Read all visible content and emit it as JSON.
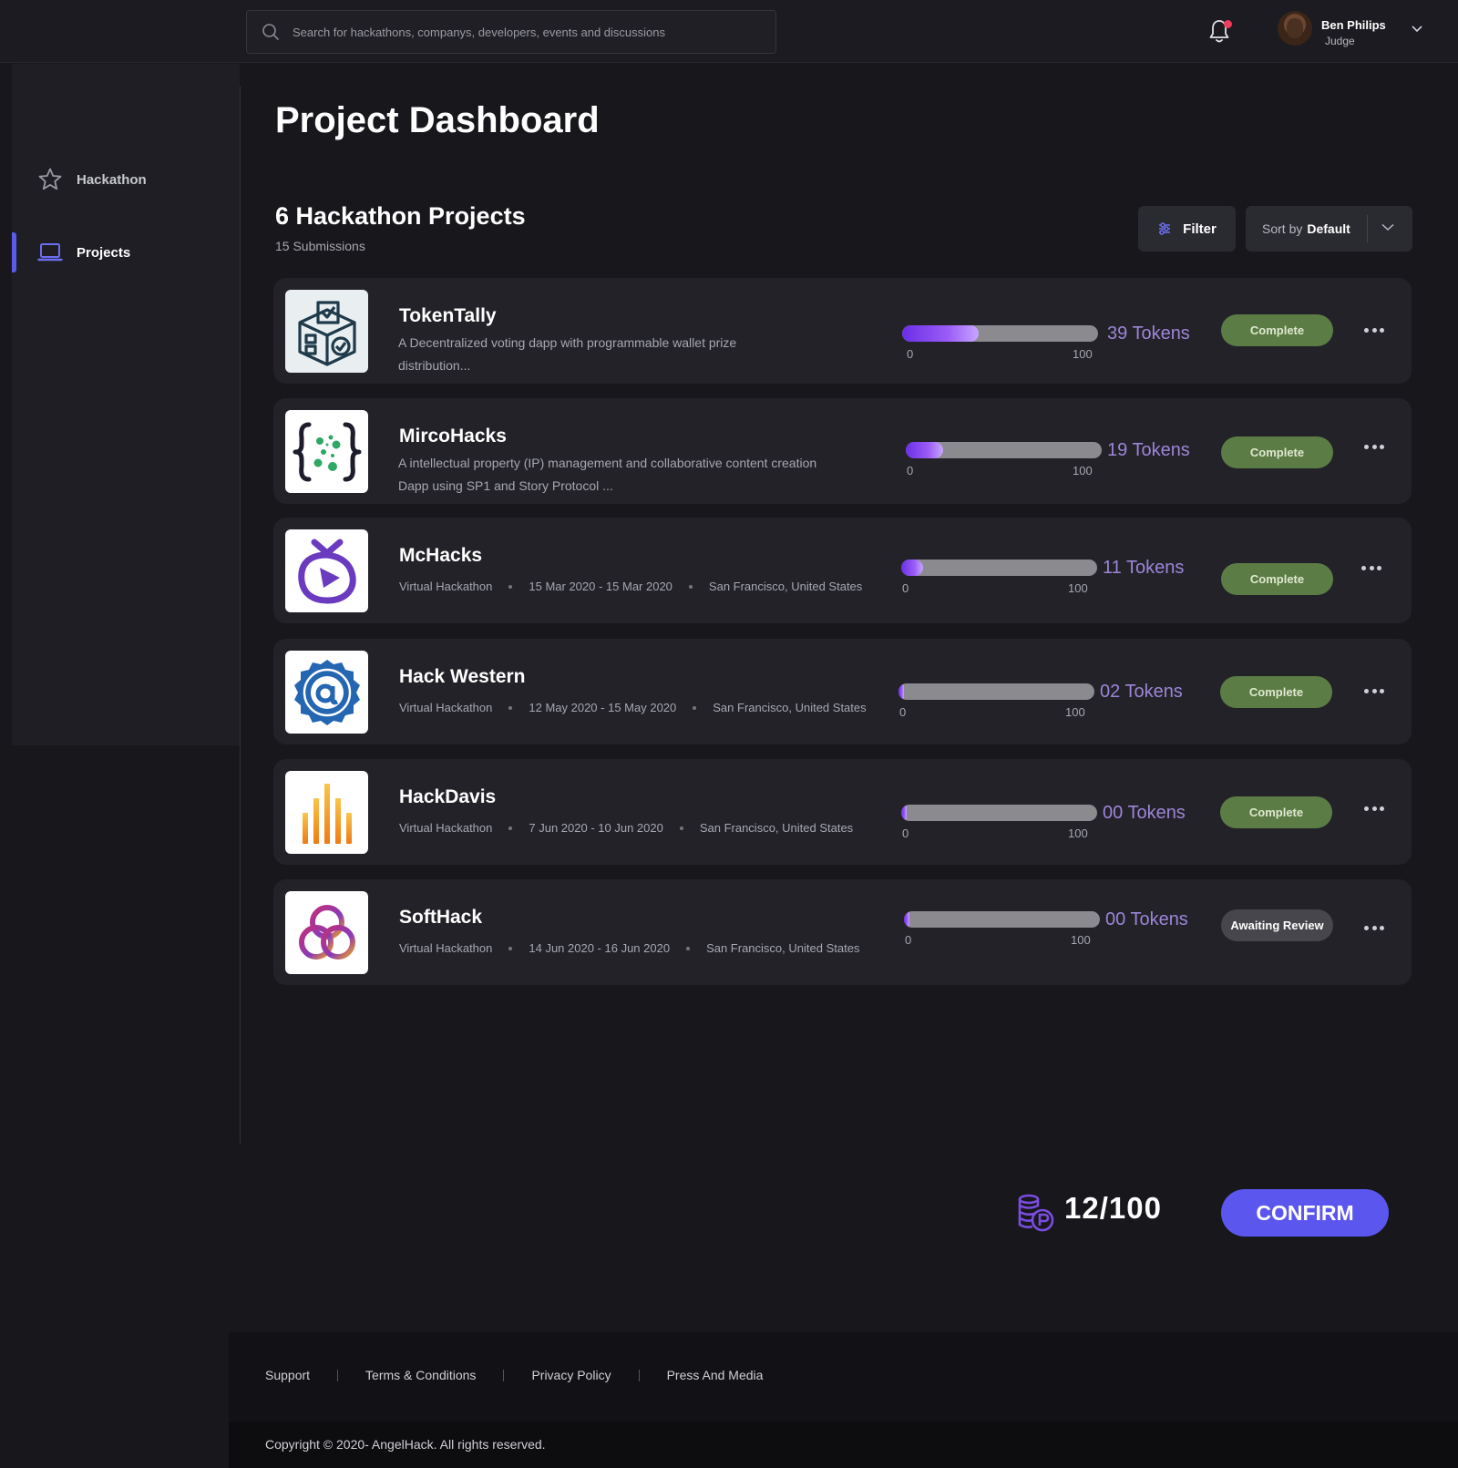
{
  "search": {
    "placeholder": "Search for hackathons, companys, developers, events and discussions"
  },
  "user": {
    "name": "Ben Philips",
    "role": "Judge"
  },
  "sidebar": {
    "items": [
      {
        "label": "Hackathon",
        "icon": "star-icon"
      },
      {
        "label": "Projects",
        "icon": "laptop-icon",
        "active": true
      }
    ]
  },
  "page": {
    "title": "Project Dashboard",
    "projects_count": "6 Hackathon Projects",
    "submissions": "15 Submissions"
  },
  "toolbar": {
    "filter_label": "Filter",
    "sort_prefix": "Sort by",
    "sort_value": "Default"
  },
  "progress_ticks": {
    "min": "0",
    "max": "100"
  },
  "projects": [
    {
      "title": "TokenTally",
      "description": "A Decentralized voting dapp with programmable wallet prize distribution...",
      "tokens_label": "39 Tokens",
      "tokens": 39,
      "status": "Complete",
      "logo": "ballot-box-icon"
    },
    {
      "title": "MircoHacks",
      "description": "A intellectual property (IP) management and collaborative content creation Dapp using SP1 and Story Protocol ...",
      "tokens_label": "19 Tokens",
      "tokens": 19,
      "status": "Complete",
      "logo": "curly-braces-dots-icon"
    },
    {
      "title": "McHacks",
      "type": "Virtual Hackathon",
      "dates": "15 Mar 2020 - 15 Mar 2020",
      "location": "San Francisco, United States",
      "tokens_label": "11 Tokens",
      "tokens": 11,
      "status": "Complete",
      "logo": "tv-play-icon"
    },
    {
      "title": "Hack Western",
      "type": "Virtual Hackathon",
      "dates": "12 May 2020 - 15 May 2020",
      "location": "San Francisco, United States",
      "tokens_label": "02 Tokens",
      "tokens": 2,
      "status": "Complete",
      "logo": "at-badge-icon"
    },
    {
      "title": "HackDavis",
      "type": "Virtual Hackathon",
      "dates": "7 Jun 2020 - 10 Jun 2020",
      "location": "San Francisco, United States",
      "tokens_label": "00 Tokens",
      "tokens": 0,
      "status": "Complete",
      "logo": "bars-icon"
    },
    {
      "title": "SoftHack",
      "type": "Virtual Hackathon",
      "dates": "14 Jun 2020 - 16 Jun 2020",
      "location": "San Francisco, United States",
      "tokens_label": "00 Tokens",
      "tokens": 0,
      "status": "Awaiting Review",
      "logo": "knot-icon"
    }
  ],
  "summary": {
    "total": "12/100",
    "confirm_label": "CONFIRM"
  },
  "footer": {
    "links": [
      "Support",
      "Terms & Conditions",
      "Privacy Policy",
      "Press And Media"
    ],
    "copyright": "Copyright © 2020- AngelHack. All rights reserved."
  },
  "colors": {
    "accent": "#5b57ee",
    "complete": "#5c7c45",
    "awaiting": "#46464c",
    "tokens": "#9d86d8"
  }
}
